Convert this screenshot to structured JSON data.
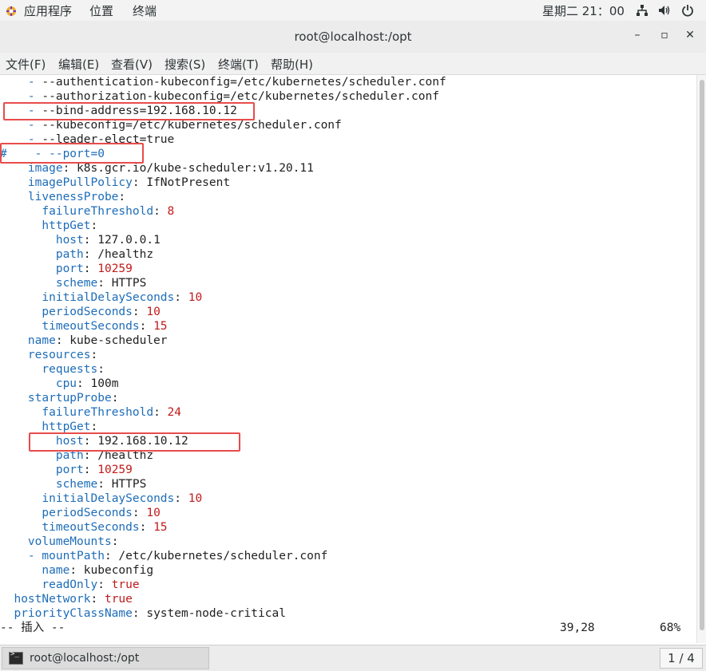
{
  "topbar": {
    "apps_label": "应用程序",
    "places_label": "位置",
    "terminal_label": "终端",
    "clock": "星期二 21：00"
  },
  "window": {
    "title": "root@localhost:/opt"
  },
  "menubar": {
    "items": [
      "文件(F)",
      "编辑(E)",
      "查看(V)",
      "搜索(S)",
      "终端(T)",
      "帮助(H)"
    ]
  },
  "editor": {
    "lines": [
      "    - --authentication-kubeconfig=/etc/kubernetes/scheduler.conf",
      "    - --authorization-kubeconfig=/etc/kubernetes/scheduler.conf",
      "    - --bind-address=192.168.10.12",
      "    - --kubeconfig=/etc/kubernetes/scheduler.conf",
      "    - --leader-elect=true",
      "#    - --port=0",
      "    image: k8s.gcr.io/kube-scheduler:v1.20.11",
      "    imagePullPolicy: IfNotPresent",
      "    livenessProbe:",
      "      failureThreshold: 8",
      "      httpGet:",
      "        host: 127.0.0.1",
      "        path: /healthz",
      "        port: 10259",
      "        scheme: HTTPS",
      "      initialDelaySeconds: 10",
      "      periodSeconds: 10",
      "      timeoutSeconds: 15",
      "    name: kube-scheduler",
      "    resources:",
      "      requests:",
      "        cpu: 100m",
      "    startupProbe:",
      "      failureThreshold: 24",
      "      httpGet:",
      "        host: 192.168.10.12",
      "        path: /healthz",
      "        port: 10259",
      "        scheme: HTTPS",
      "      initialDelaySeconds: 10",
      "      periodSeconds: 10",
      "      timeoutSeconds: 15",
      "    volumeMounts:",
      "    - mountPath: /etc/kubernetes/scheduler.conf",
      "      name: kubeconfig",
      "      readOnly: true",
      "  hostNetwork: true",
      "  priorityClassName: system-node-critical"
    ],
    "mode": "-- 插入 --",
    "cursor_pos": "39,28",
    "scroll_percent": "68%"
  },
  "taskbar": {
    "task_label": "root@localhost:/opt",
    "workspace": "1 / 4"
  },
  "colors": {
    "key": "#1e6db8",
    "number": "#c01a1a",
    "highlight_box": "#e84c4c"
  }
}
